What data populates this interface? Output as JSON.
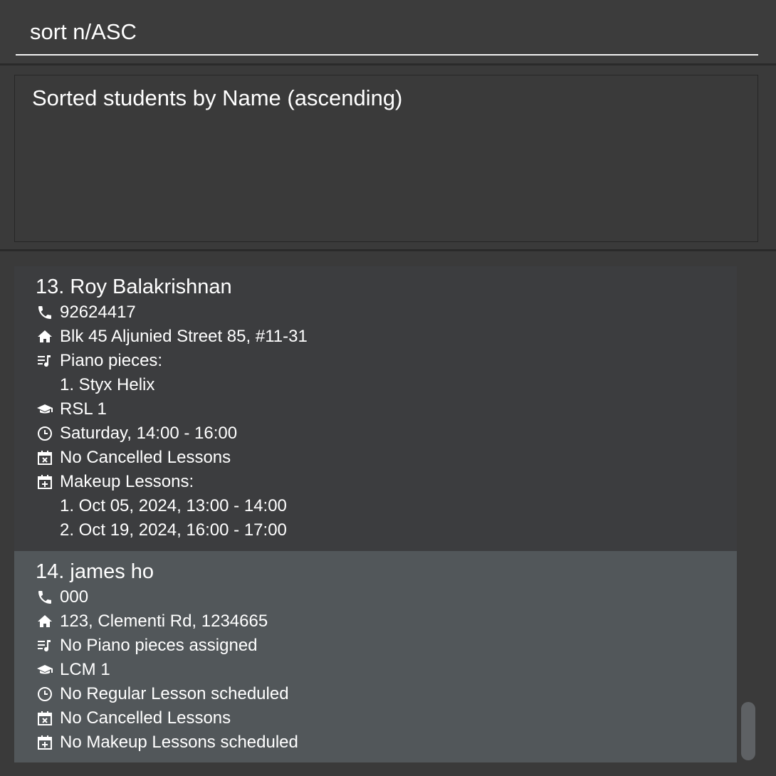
{
  "command": {
    "value": "sort n/ASC"
  },
  "result": {
    "message": "Sorted students by Name (ascending)"
  },
  "students": [
    {
      "title": "13. Roy Balakrishnan",
      "phone": "92624417",
      "address": "Blk 45 Aljunied Street 85, #11-31",
      "pieces_label": "Piano pieces:",
      "pieces": [
        "1. Styx Helix"
      ],
      "grade": "RSL 1",
      "regular": "Saturday, 14:00 - 16:00",
      "cancelled": "No Cancelled Lessons",
      "makeup_label": "Makeup Lessons:",
      "makeups": [
        "1. Oct 05, 2024, 13:00 - 14:00",
        "2. Oct 19, 2024, 16:00 - 17:00"
      ]
    },
    {
      "title": "14. james ho",
      "phone": "000",
      "address": "123, Clementi Rd, 1234665",
      "pieces_label": "No Piano pieces assigned",
      "grade": "LCM 1",
      "regular": "No Regular Lesson scheduled",
      "cancelled": "No Cancelled Lessons",
      "makeup_label": "No Makeup Lessons scheduled"
    }
  ],
  "icons": [
    "phone-icon",
    "home-icon",
    "music-list-icon",
    "graduation-cap-icon",
    "clock-icon",
    "calendar-x-icon",
    "calendar-plus-icon"
  ],
  "colors": {
    "background": "#3a3a3a",
    "selected_card": "#52575a",
    "card": "#3c3d3f",
    "text": "#ffffff"
  }
}
